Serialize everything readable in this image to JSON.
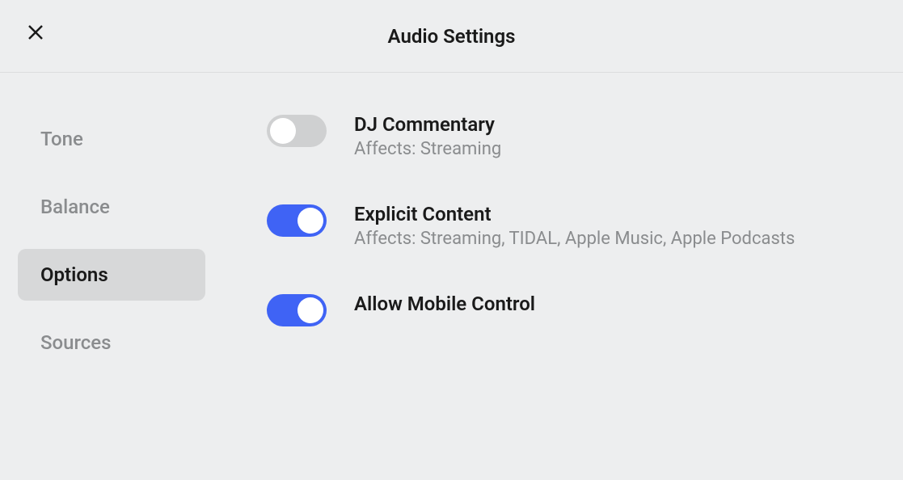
{
  "header": {
    "title": "Audio Settings"
  },
  "sidebar": {
    "items": [
      {
        "label": "Tone",
        "active": false
      },
      {
        "label": "Balance",
        "active": false
      },
      {
        "label": "Options",
        "active": true
      },
      {
        "label": "Sources",
        "active": false
      }
    ]
  },
  "settings": [
    {
      "label": "DJ Commentary",
      "sub": "Affects: Streaming",
      "on": false
    },
    {
      "label": "Explicit Content",
      "sub": "Affects: Streaming, TIDAL, Apple Music, Apple Podcasts",
      "on": true
    },
    {
      "label": "Allow Mobile Control",
      "sub": "",
      "on": true
    }
  ]
}
